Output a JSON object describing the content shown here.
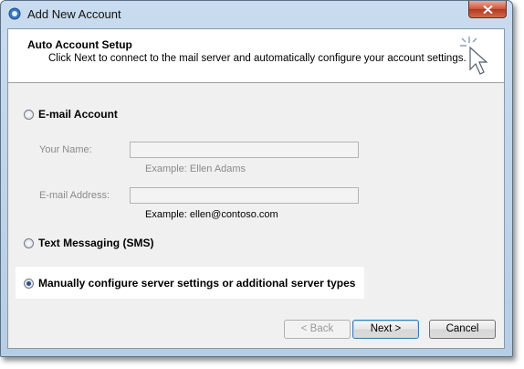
{
  "window": {
    "title": "Add New Account",
    "app_icon": "outlook-icon",
    "close_icon": "close-icon"
  },
  "header": {
    "title": "Auto Account Setup",
    "description": "Click Next to connect to the mail server and automatically configure your account settings.",
    "icon": "cursor-sparkle-icon"
  },
  "options": {
    "email_account": {
      "label": "E-mail Account",
      "selected": false
    },
    "text_messaging": {
      "label": "Text Messaging (SMS)",
      "selected": false
    },
    "manual_config": {
      "label": "Manually configure server settings or additional server types",
      "selected": true
    }
  },
  "fields": {
    "your_name": {
      "label": "Your Name:",
      "value": "",
      "example": "Example: Ellen Adams"
    },
    "email_address": {
      "label": "E-mail Address:",
      "value": "",
      "example": "Example: ellen@contoso.com"
    }
  },
  "buttons": {
    "back": "< Back",
    "next": "Next >",
    "cancel": "Cancel"
  }
}
